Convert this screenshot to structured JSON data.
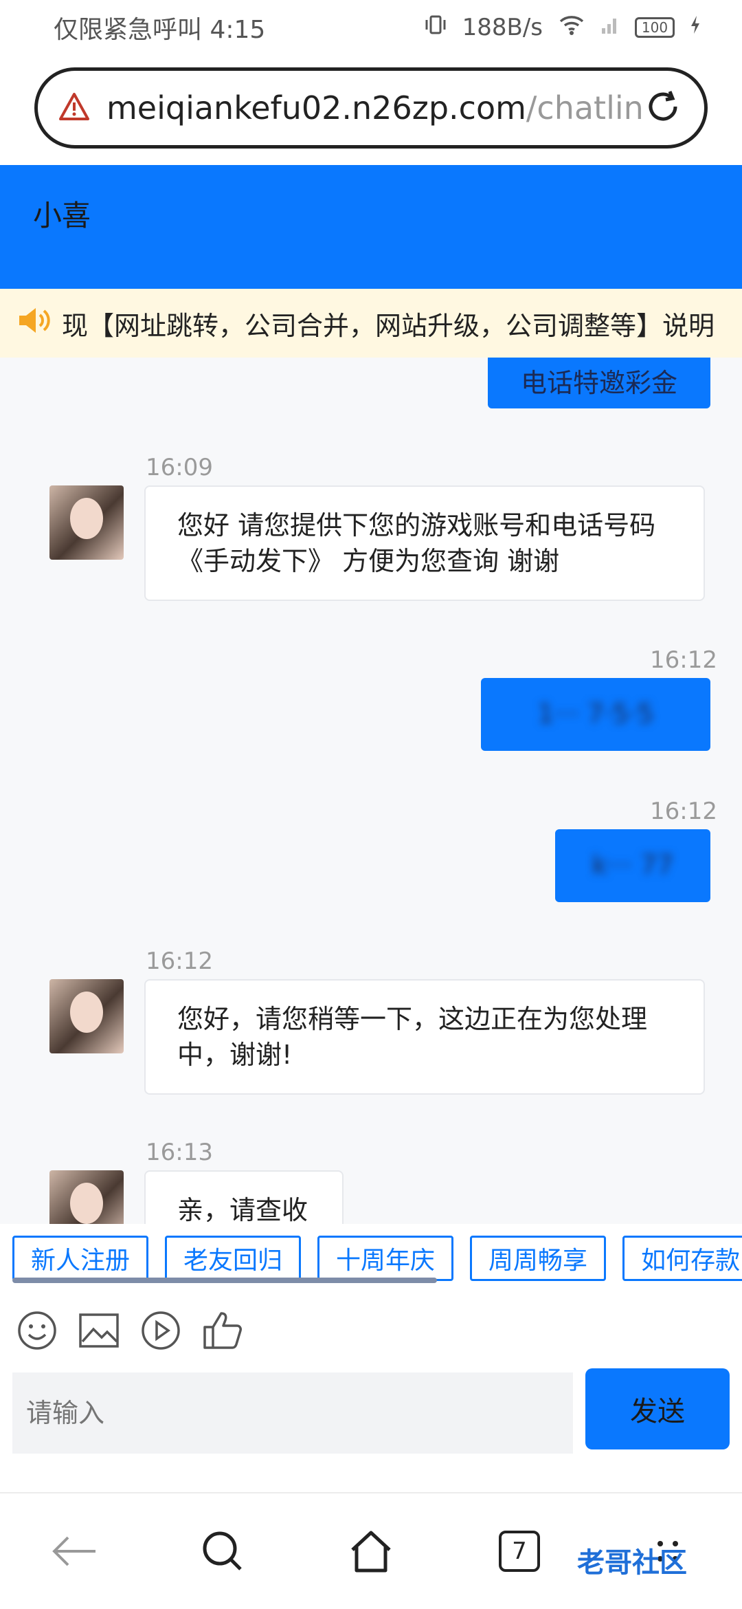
{
  "status_bar": {
    "left_text": "仅限紧急呼叫",
    "time": "4:15",
    "network_speed": "188B/s",
    "battery": "100"
  },
  "url_bar": {
    "url_main": "meiqiankefu02.n26zp.com",
    "url_rest": "/chatlin",
    "warning_icon": "warning-triangle-icon",
    "reload_icon": "reload-icon"
  },
  "chat": {
    "agent_name": "小喜",
    "notice": "现【网址跳转，公司合并，网站升级，公司调整等】说明",
    "messages": [
      {
        "dir": "out",
        "text": "电话特邀彩金"
      },
      {
        "dir": "in",
        "time": "16:09",
        "text_line1": "您好 请您提供下您的游戏账号和电话号码",
        "text_line2": "《手动发下》 方便为您查询 谢谢"
      },
      {
        "dir": "out",
        "time": "16:12",
        "text": "1··· 7·5·5"
      },
      {
        "dir": "out",
        "time": "16:12",
        "text": "k··· 77"
      },
      {
        "dir": "in",
        "time": "16:12",
        "text_line1": "您好，请您稍等一下，这边正在为您处理",
        "text_line2": "中，谢谢!"
      },
      {
        "dir": "in",
        "time": "16:13",
        "text_line1": "亲，请查收"
      }
    ]
  },
  "quick_replies": [
    "新人注册",
    "老友回归",
    "十周年庆",
    "周周畅享",
    "如何存款"
  ],
  "toolbar_icons": [
    "emoji-icon",
    "image-icon",
    "video-icon",
    "thumbs-up-icon"
  ],
  "input": {
    "placeholder": "请输入",
    "send_label": "发送"
  },
  "nav": {
    "tabs_count": "7"
  },
  "watermark": "老哥社区"
}
